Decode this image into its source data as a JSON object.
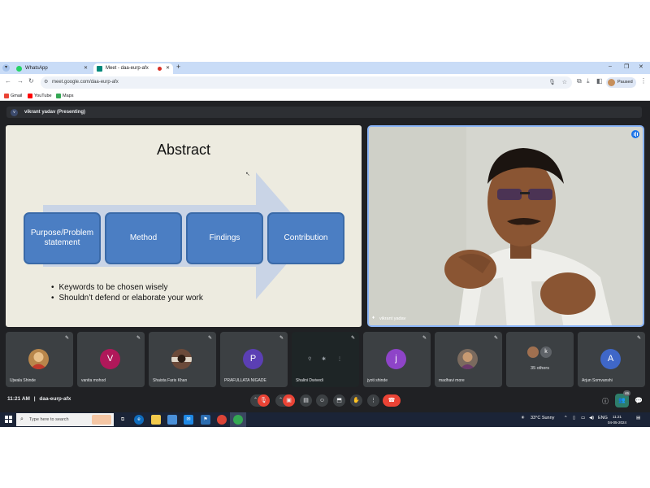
{
  "browser": {
    "tabs": [
      {
        "title": "WhatsApp",
        "active": false,
        "favicon_color": "#25d366"
      },
      {
        "title": "Meet - daa-eurp-afx",
        "active": true,
        "favicon_color": "#00897b"
      }
    ],
    "url": "meet.google.com/daa-eurp-afx",
    "profile_label": "Paused",
    "bookmarks": [
      {
        "label": "Gmail",
        "icon": "gmail-icon",
        "color": "#ea4335"
      },
      {
        "label": "YouTube",
        "icon": "youtube-icon",
        "color": "#ff0000"
      },
      {
        "label": "Maps",
        "icon": "maps-icon",
        "color": "#34a853"
      }
    ]
  },
  "meet": {
    "presenter_avatar_initial": "v",
    "presenting_label": "vikrant yadav (Presenting)",
    "slide": {
      "title": "Abstract",
      "boxes": [
        "Purpose/Problem statement",
        "Method",
        "Findings",
        "Contribution"
      ],
      "bullets": [
        "Keywords to be chosen wisely",
        "Shouldn’t defend or elaborate your work"
      ]
    },
    "video_name": "vikrant yadav",
    "participants": [
      {
        "name": "Ujwala Shinde",
        "initial": "",
        "color": "#b8864b",
        "kind": "photo"
      },
      {
        "name": "vanita mohod",
        "initial": "V",
        "color": "#b0185a",
        "kind": "letter"
      },
      {
        "name": "Shaista Faris Khan",
        "initial": "",
        "color": "#6b4a3a",
        "kind": "photo"
      },
      {
        "name": "PRAFULLATA NIGADE",
        "initial": "P",
        "color": "#5b3fb4",
        "kind": "letter"
      },
      {
        "name": "Shalini Dwivedi",
        "initial": "",
        "color": "#1e2526",
        "kind": "video"
      },
      {
        "name": "jyoti shinde",
        "initial": "j",
        "color": "#8e44c8",
        "kind": "letter"
      },
      {
        "name": "madhavi more",
        "initial": "",
        "color": "#7a6a5e",
        "kind": "photo"
      },
      {
        "name": "35 others",
        "initial": "k",
        "color": "#5f6368",
        "kind": "others"
      },
      {
        "name": "Arjun Somvanshi",
        "initial": "A",
        "color": "#3f67c8",
        "kind": "letter"
      }
    ],
    "time": "11:21 AM",
    "separator": "|",
    "meeting_code": "daa-eurp-afx",
    "people_count": "46"
  },
  "taskbar": {
    "search_placeholder": "Type here to search",
    "weather": "33°C  Sunny",
    "language": "ENG",
    "clock_time": "11:21",
    "clock_date": "04-05-2024"
  }
}
